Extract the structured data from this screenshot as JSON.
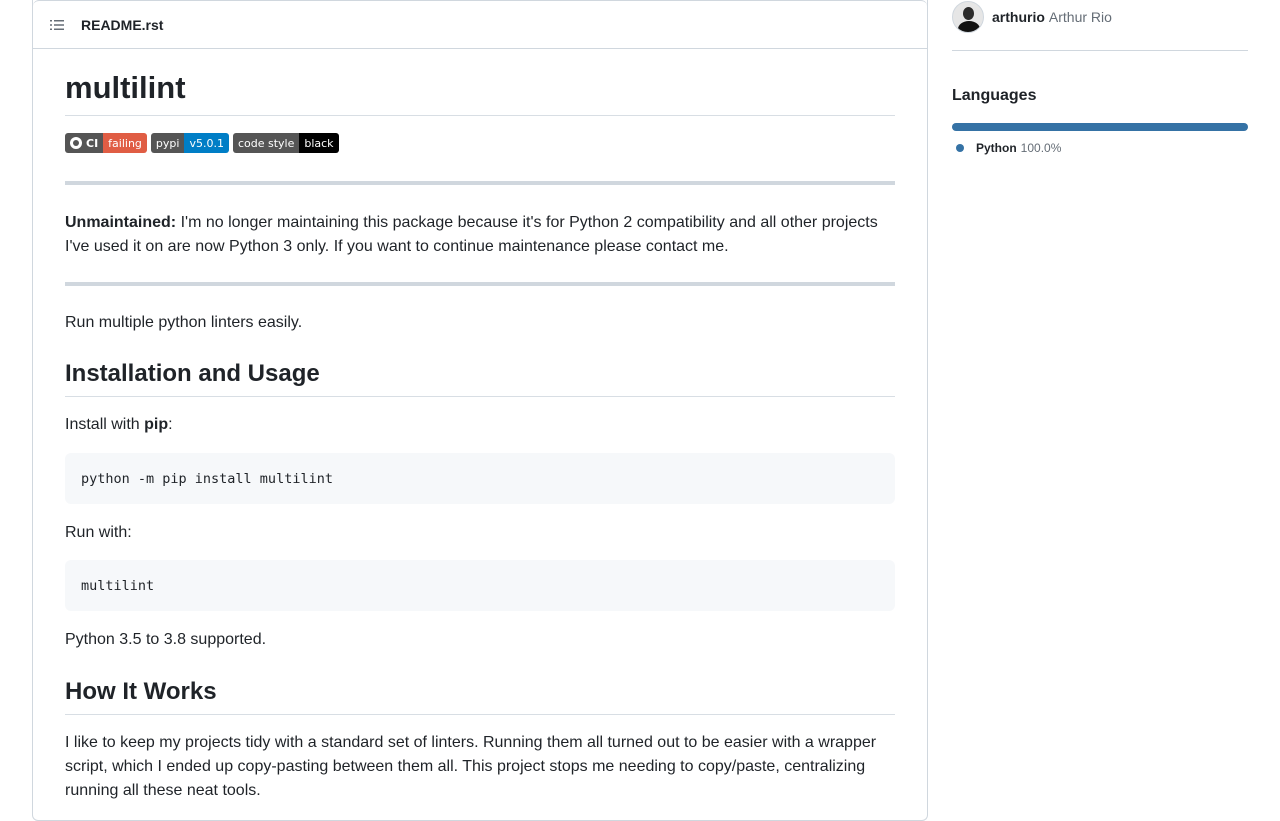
{
  "readme": {
    "filename": "README.rst",
    "title": "multilint",
    "badges": {
      "ci_label": "CI",
      "ci_status": "failing",
      "pypi_label": "pypi",
      "pypi_version": "v5.0.1",
      "style_label": "code style",
      "style_value": "black"
    },
    "unmaintained_bold": "Unmaintained:",
    "unmaintained_text": " I'm no longer maintaining this package because it's for Python 2 compatibility and all other projects I've used it on are now Python 3 only. If you want to continue maintenance please contact me.",
    "intro": "Run multiple python linters easily.",
    "section_install": "Installation and Usage",
    "install_prefix": "Install with ",
    "install_pip": "pip",
    "install_suffix": ":",
    "install_code": "python -m pip install multilint",
    "run_with": "Run with:",
    "run_code": "multilint",
    "supported": "Python 3.5 to 3.8 supported.",
    "section_how": "How It Works",
    "how_text": "I like to keep my projects tidy with a standard set of linters. Running them all turned out to be easier with a wrapper script, which I ended up copy-pasting between them all. This project stops me needing to copy/paste, centralizing running all these neat tools."
  },
  "sidebar": {
    "contributor_login": "arthurio",
    "contributor_name": "Arthur Rio",
    "languages_title": "Languages",
    "language_name": "Python",
    "language_pct": "100.0%",
    "language_color": "#3572A5"
  }
}
